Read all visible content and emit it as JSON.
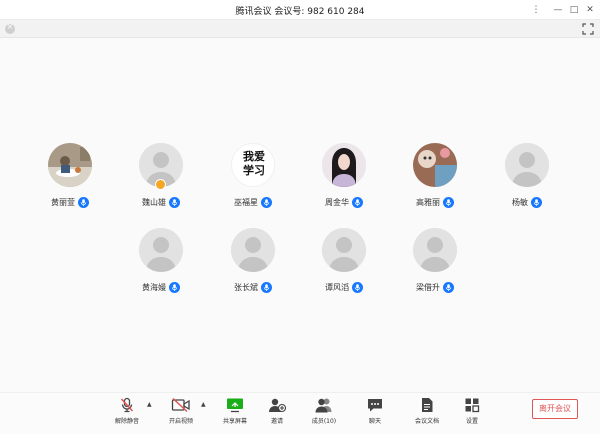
{
  "window": {
    "title": "腾讯会议  会议号: 982 610 284"
  },
  "window_controls": {
    "menu": "⋮",
    "minimize": "—",
    "maximize": "□",
    "close": "✕"
  },
  "participants": [
    {
      "name": "黄丽萱",
      "avatar": "photo-food",
      "mic": true
    },
    {
      "name": "魏山雄",
      "avatar": "default",
      "mic": true,
      "host": true
    },
    {
      "name": "巫福星",
      "avatar": "text",
      "avatar_text_1": "我爱",
      "avatar_text_2": "学习",
      "mic": true
    },
    {
      "name": "周金华",
      "avatar": "photo-girl",
      "mic": true
    },
    {
      "name": "高雅丽",
      "avatar": "photo-cartoon",
      "mic": true
    },
    {
      "name": "杨敏",
      "avatar": "default",
      "mic": true
    },
    {
      "name": "黄海嫚",
      "avatar": "default",
      "mic": true
    },
    {
      "name": "张长斌",
      "avatar": "default",
      "mic": true
    },
    {
      "name": "谭风滔",
      "avatar": "default",
      "mic": true
    },
    {
      "name": "梁借升",
      "avatar": "default",
      "mic": true
    }
  ],
  "toolbar": {
    "unmute_label": "解除静音",
    "video_label": "开启视频",
    "share_label": "共享屏幕",
    "invite_label": "邀请",
    "members_label": "成员(10)",
    "chat_label": "聊天",
    "docs_label": "会议文档",
    "settings_label": "设置",
    "leave_label": "离开会议"
  },
  "colors": {
    "mic_blue": "#1677ff",
    "muted_red": "#e05555",
    "share_green": "#1aad19",
    "leave_red": "#e05555"
  }
}
